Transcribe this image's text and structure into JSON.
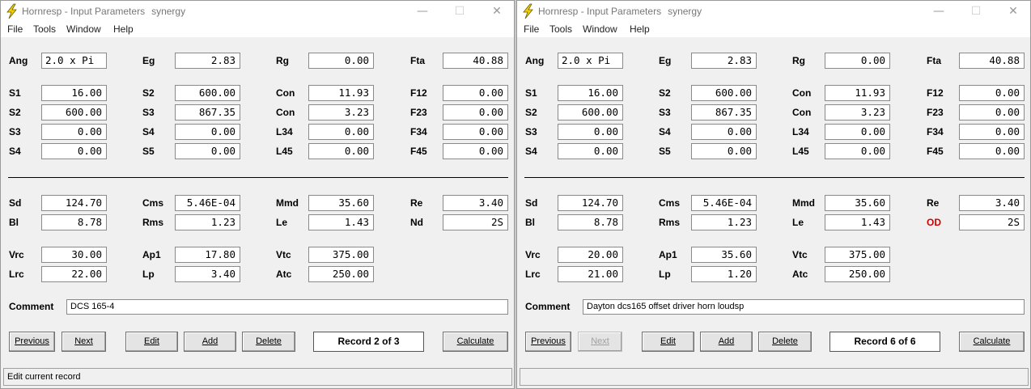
{
  "app": {
    "title": "Hornresp - Input Parameters",
    "user": "synergy",
    "icon": "lightning-bolt-icon"
  },
  "menu": [
    "File",
    "Tools",
    "Window",
    "Help"
  ],
  "window_controls": {
    "minimize": "—",
    "maximize": "☐",
    "close": "✕"
  },
  "buttons": {
    "previous": "Previous",
    "next": "Next",
    "edit": "Edit",
    "add": "Add",
    "delete": "Delete",
    "calculate": "Calculate"
  },
  "colors": {
    "od_label": "#d00000"
  },
  "windows": [
    {
      "labels": {
        "ang": "Ang",
        "eg": "Eg",
        "rg": "Rg",
        "fta": "Fta",
        "s1": "S1",
        "s2a": "S2",
        "con1": "Con",
        "f12": "F12",
        "s2b": "S2",
        "s3a": "S3",
        "con2": "Con",
        "f23": "F23",
        "s3b": "S3",
        "s4a": "S4",
        "l34": "L34",
        "f34": "F34",
        "s4b": "S4",
        "s5": "S5",
        "l45": "L45",
        "f45": "F45",
        "sd": "Sd",
        "cms": "Cms",
        "mmd": "Mmd",
        "re": "Re",
        "bl": "Bl",
        "rms": "Rms",
        "le": "Le",
        "nd": "Nd",
        "vrc": "Vrc",
        "ap1": "Ap1",
        "vtc": "Vtc",
        "lrc": "Lrc",
        "lp": "Lp",
        "atc": "Atc",
        "comment": "Comment"
      },
      "values": {
        "ang": "2.0 x Pi",
        "eg": "2.83",
        "rg": "0.00",
        "fta": "40.88",
        "s1": "16.00",
        "s2a": "600.00",
        "con1": "11.93",
        "f12": "0.00",
        "s2b": "600.00",
        "s3a": "867.35",
        "con2": "3.23",
        "f23": "0.00",
        "s3b": "0.00",
        "s4a": "0.00",
        "l34": "0.00",
        "f34": "0.00",
        "s4b": "0.00",
        "s5": "0.00",
        "l45": "0.00",
        "f45": "0.00",
        "sd": "124.70",
        "cms": "5.46E-04",
        "mmd": "35.60",
        "re": "3.40",
        "bl": "8.78",
        "rms": "1.23",
        "le": "1.43",
        "nd": "2S",
        "vrc": "30.00",
        "ap1": "17.80",
        "vtc": "375.00",
        "lrc": "22.00",
        "lp": "3.40",
        "atc": "250.00"
      },
      "comment": "DCS 165-4",
      "record": "Record 2 of 3",
      "next_enabled": true,
      "status": "Edit current record"
    },
    {
      "labels": {
        "ang": "Ang",
        "eg": "Eg",
        "rg": "Rg",
        "fta": "Fta",
        "s1": "S1",
        "s2a": "S2",
        "con1": "Con",
        "f12": "F12",
        "s2b": "S2",
        "s3a": "S3",
        "con2": "Con",
        "f23": "F23",
        "s3b": "S3",
        "s4a": "S4",
        "l34": "L34",
        "f34": "F34",
        "s4b": "S4",
        "s5": "S5",
        "l45": "L45",
        "f45": "F45",
        "sd": "Sd",
        "cms": "Cms",
        "mmd": "Mmd",
        "re": "Re",
        "bl": "Bl",
        "rms": "Rms",
        "le": "Le",
        "nd": "OD",
        "vrc": "Vrc",
        "ap1": "Ap1",
        "vtc": "Vtc",
        "lrc": "Lrc",
        "lp": "Lp",
        "atc": "Atc",
        "comment": "Comment"
      },
      "values": {
        "ang": "2.0 x Pi",
        "eg": "2.83",
        "rg": "0.00",
        "fta": "40.88",
        "s1": "16.00",
        "s2a": "600.00",
        "con1": "11.93",
        "f12": "0.00",
        "s2b": "600.00",
        "s3a": "867.35",
        "con2": "3.23",
        "f23": "0.00",
        "s3b": "0.00",
        "s4a": "0.00",
        "l34": "0.00",
        "f34": "0.00",
        "s4b": "0.00",
        "s5": "0.00",
        "l45": "0.00",
        "f45": "0.00",
        "sd": "124.70",
        "cms": "5.46E-04",
        "mmd": "35.60",
        "re": "3.40",
        "bl": "8.78",
        "rms": "1.23",
        "le": "1.43",
        "nd": "2S",
        "vrc": "20.00",
        "ap1": "35.60",
        "vtc": "375.00",
        "lrc": "21.00",
        "lp": "1.20",
        "atc": "250.00"
      },
      "comment": "Dayton dcs165 offset driver horn loudsp",
      "record": "Record 6 of 6",
      "next_enabled": false,
      "status": ""
    }
  ]
}
